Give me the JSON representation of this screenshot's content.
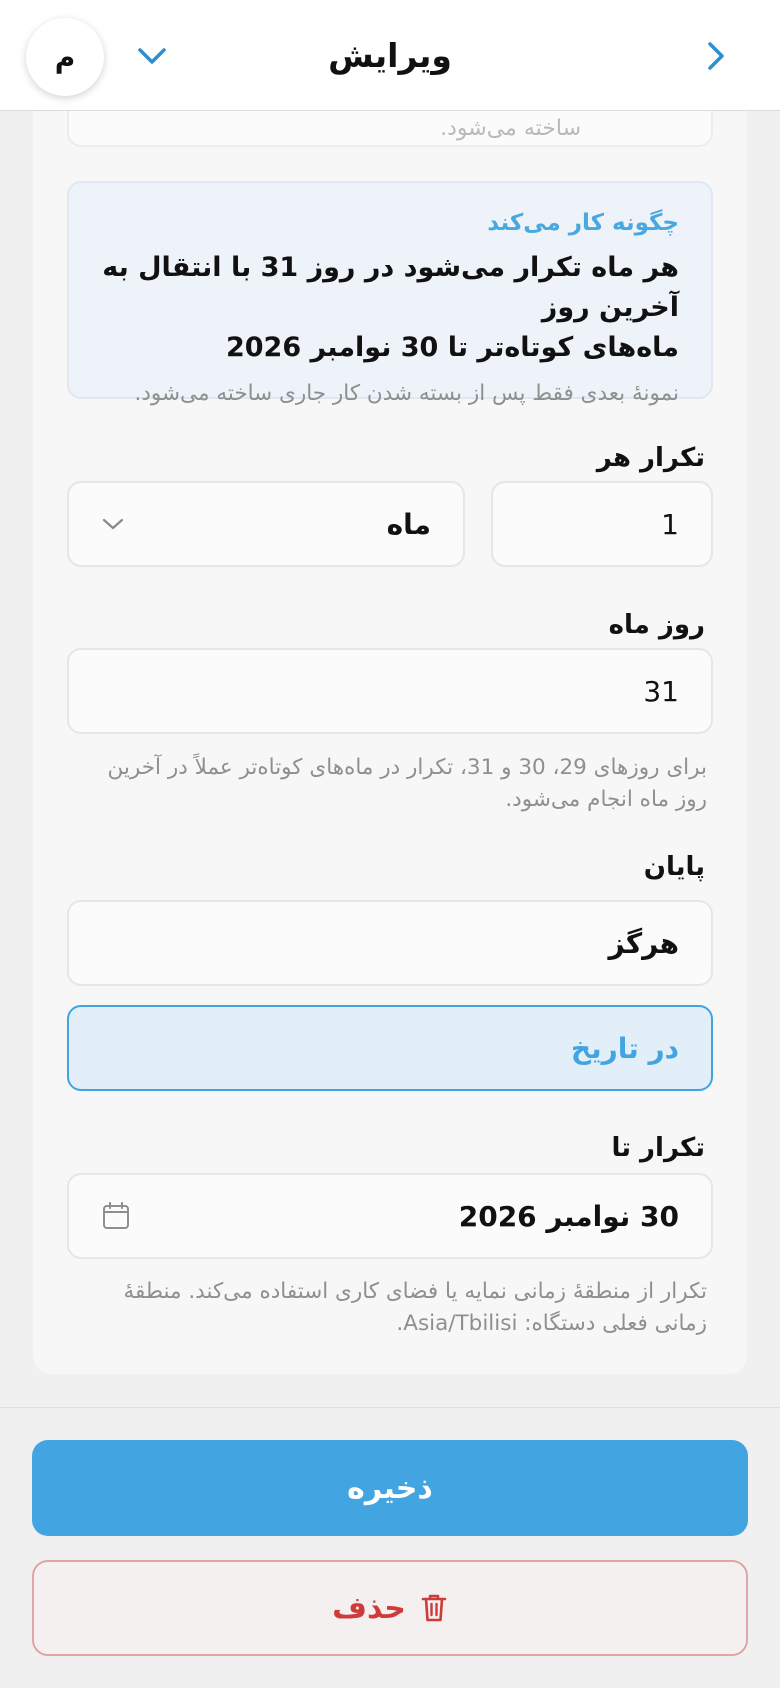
{
  "header": {
    "title": "ویرایش",
    "avatar_letter": "م"
  },
  "previous_card": {
    "text": "ساخته می‌شود."
  },
  "info": {
    "title": "چگونه کار می‌کند",
    "main_line1": "هر ماه تکرار می‌شود در روز 31 با انتقال به آخرین روز",
    "main_line2": "ماه‌های کوتاه‌تر تا 30 نوامبر 2026",
    "note": "نمونهٔ بعدی فقط پس از بسته شدن کار جاری ساخته می‌شود."
  },
  "repeat_every": {
    "label": "تکرار هر",
    "interval_value": "1",
    "unit_value": "ماه"
  },
  "day_of_month": {
    "label": "روز ماه",
    "value": "31",
    "help": "برای روزهای 29، 30 و 31، تکرار در ماه‌های کوتاه‌تر عملاً در آخرین روز ماه انجام می‌شود."
  },
  "end": {
    "label": "پایان",
    "option_never": "هرگز",
    "option_on_date": "در تاریخ"
  },
  "repeat_until": {
    "label": "تکرار تا",
    "value": "30 نوامبر 2026",
    "help": "تکرار از منطقهٔ زمانی نمایه یا فضای کاری استفاده می‌کند. منطقهٔ زمانی فعلی دستگاه: Asia/Tbilisi."
  },
  "actions": {
    "save_label": "ذخیره",
    "delete_label": "حذف"
  },
  "colors": {
    "accent": "#42a5e2",
    "danger": "#cf3b3b",
    "info_bg": "#edf3f9"
  }
}
